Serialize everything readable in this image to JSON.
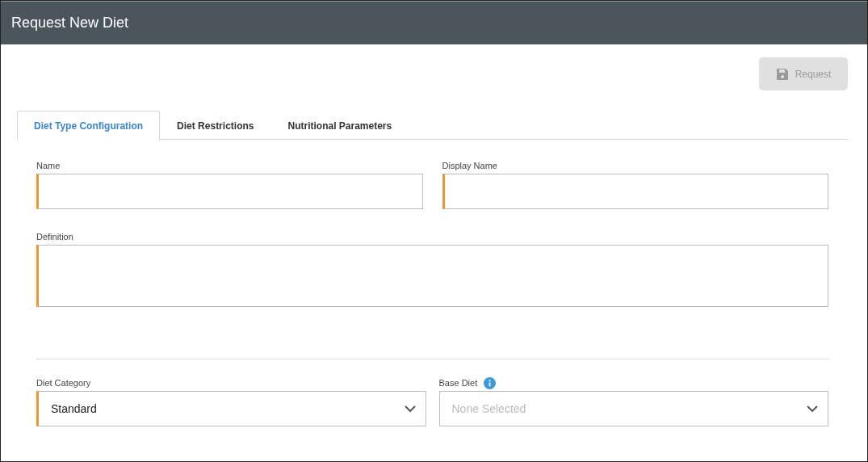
{
  "window": {
    "title": "Request New Diet"
  },
  "request_button": {
    "label": "Request",
    "disabled": true
  },
  "tabs": [
    {
      "label": "Diet Type Configuration",
      "selected": true
    },
    {
      "label": "Diet Restrictions",
      "selected": false
    },
    {
      "label": "Nutritional Parameters",
      "selected": false
    }
  ],
  "fields": [
    {
      "label": "Name",
      "required": true
    },
    {
      "label": "Display Name",
      "required": true
    }
  ],
  "definition": {
    "label": "Definition",
    "required": true
  },
  "dropdowns": [
    {
      "label": "Diet Category",
      "value": "Standard",
      "required": true,
      "info": false
    },
    {
      "label": "Base Diet",
      "placeholder": "None Selected",
      "required": false,
      "info": true
    }
  ]
}
